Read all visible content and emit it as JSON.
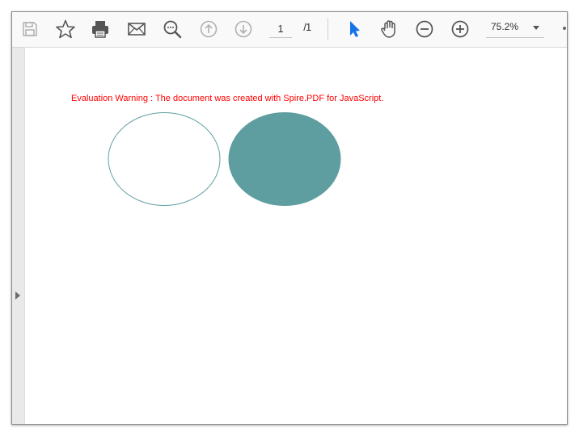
{
  "toolbar": {
    "icons": [
      "save-icon",
      "bookmark-star-icon",
      "print-icon",
      "email-icon",
      "search-icon",
      "previous-page-icon",
      "next-page-icon",
      "select-cursor-icon",
      "hand-tool-icon",
      "zoom-out-icon",
      "zoom-in-icon"
    ],
    "current_page": "1",
    "page_separator": "/",
    "total_pages": "1",
    "zoom_level": "75.2%"
  },
  "document": {
    "warning_text": "Evaluation Warning : The document was created with Spire.PDF for JavaScript.",
    "warning_color": "#ff0000",
    "shapes": [
      {
        "kind": "ellipse",
        "style": "outline",
        "stroke": "#5f9ea0",
        "fill": "none"
      },
      {
        "kind": "ellipse",
        "style": "filled",
        "stroke": "#5f9ea0",
        "fill": "#5f9ea0"
      }
    ]
  },
  "colors": {
    "accent_cursor": "#1473e6",
    "icon_gray": "#555555",
    "icon_disabled": "#b0b0b0"
  }
}
